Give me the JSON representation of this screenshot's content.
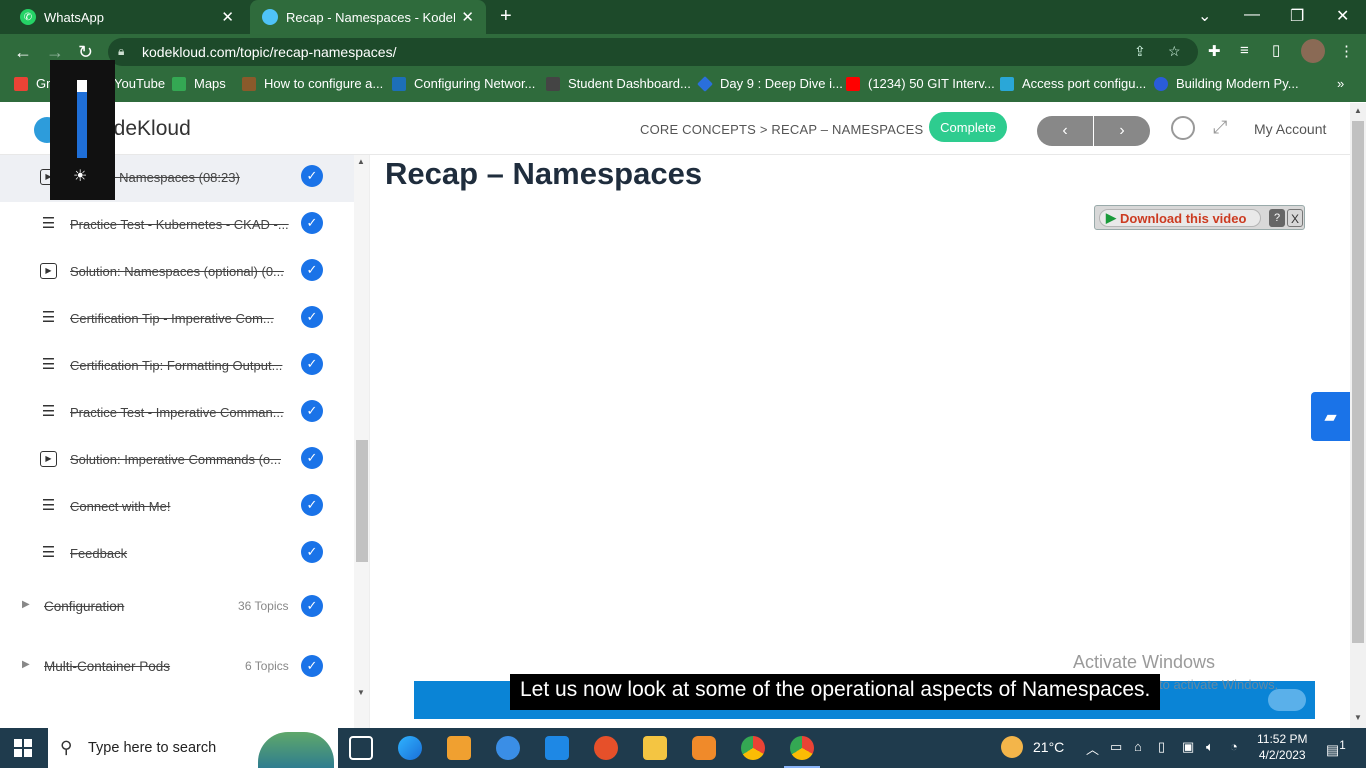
{
  "browser": {
    "tabs": [
      {
        "title": "WhatsApp",
        "favicon": "whatsapp-icon",
        "active": false
      },
      {
        "title": "Recap - Namespaces - KodeKloud",
        "favicon": "kodekloud-icon",
        "active": true
      }
    ],
    "url": "kodekloud.com/topic/recap-namespaces/",
    "bookmarks": [
      {
        "label": "Gmail",
        "icon": "gmail-icon",
        "color": "#ea4335"
      },
      {
        "label": "YouTube",
        "icon": "youtube-icon",
        "color": "#ff0000"
      },
      {
        "label": "Maps",
        "icon": "maps-icon",
        "color": "#34a853"
      },
      {
        "label": "How to configure a...",
        "icon": "bookmark-icon",
        "color": "#8a5a2b"
      },
      {
        "label": "Configuring Networ...",
        "icon": "vmware-icon",
        "color": "#1d6fb8"
      },
      {
        "label": "Student Dashboard...",
        "icon": "dashboard-icon",
        "color": "#444444"
      },
      {
        "label": "Day 9 : Deep Dive i...",
        "icon": "diamond-icon",
        "color": "#2a6fdb"
      },
      {
        "label": "(1234) 50 GIT Interv...",
        "icon": "youtube-icon",
        "color": "#ff0000"
      },
      {
        "label": "Access port configu...",
        "icon": "network-icon",
        "color": "#2aa7d8"
      },
      {
        "label": "Building Modern Py...",
        "icon": "c-icon",
        "color": "#2a5cd8"
      }
    ]
  },
  "header": {
    "logo": "KodeKloud",
    "breadcrumb": "CORE CONCEPTS > RECAP – NAMESPACES",
    "complete_label": "Complete",
    "prev_label": "‹",
    "next_label": "›",
    "account_label": "My Account"
  },
  "sidebar": {
    "lessons": [
      {
        "label": "Recap - Namespaces (08:23)",
        "type": "video",
        "done": true
      },
      {
        "label": "Practice Test - Kubernetes - CKAD -...",
        "type": "text",
        "done": true
      },
      {
        "label": "Solution: Namespaces (optional) (0...",
        "type": "video",
        "done": true
      },
      {
        "label": "Certification Tip - Imperative Com...",
        "type": "text",
        "done": true
      },
      {
        "label": "Certification Tip: Formatting Output...",
        "type": "text",
        "done": true
      },
      {
        "label": "Practice Test - Imperative Comman...",
        "type": "text",
        "done": true
      },
      {
        "label": "Solution: Imperative Commands (o...",
        "type": "video",
        "done": true
      },
      {
        "label": "Connect with Me!",
        "type": "text",
        "done": true
      },
      {
        "label": "Feedback",
        "type": "text",
        "done": true
      }
    ],
    "sections": [
      {
        "label": "Configuration",
        "count": "36 Topics",
        "done": true
      },
      {
        "label": "Multi-Container Pods",
        "count": "6 Topics",
        "done": true
      }
    ]
  },
  "main": {
    "title": "Recap – Namespaces",
    "download_label": "Download this video",
    "download_help": "?",
    "download_close": "X",
    "caption": "Let us now look at some of the operational aspects of Namespaces."
  },
  "watermark": {
    "line1": "Activate Windows",
    "line2": "Go to Settings to activate Windows."
  },
  "taskbar": {
    "search_placeholder": "Type here to search",
    "temperature": "21°C",
    "time": "11:52 PM",
    "date": "4/2/2023",
    "notification_count": "1"
  },
  "colors": {
    "browser_frame": "#2f6b3c",
    "accent_blue": "#1a73e8",
    "complete_green": "#2ecc8f"
  }
}
